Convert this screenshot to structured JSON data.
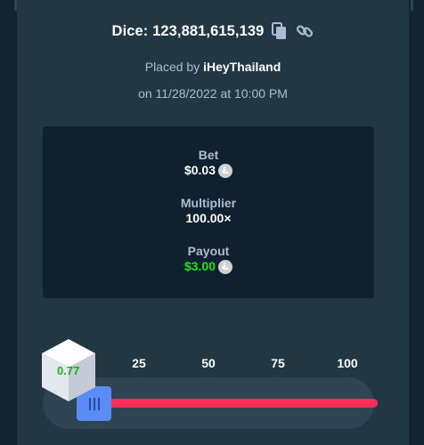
{
  "header": {
    "title": "Dice: 123,881,615,139"
  },
  "icons": {
    "copy": "copy-icon",
    "link": "link-icon",
    "currency": "litecoin-icon",
    "slider_handle": "grip-lines-icon"
  },
  "placement": {
    "prefix": "Placed by ",
    "user": "iHeyThailand",
    "date": "on 11/28/2022 at 10:00 PM"
  },
  "stats": {
    "bet": {
      "label": "Bet",
      "value": "$0.03"
    },
    "multiplier": {
      "label": "Multiplier",
      "value": "100.00×"
    },
    "payout": {
      "label": "Payout",
      "value": "$3.00"
    }
  },
  "slider": {
    "ticks": [
      "25",
      "50",
      "75",
      "100"
    ],
    "result": "0.77",
    "track_range": [
      0,
      100
    ]
  },
  "colors": {
    "win": "#1fe61f",
    "lose": "#ff2e57",
    "handle": "#5a8cf5",
    "panel": "#213743",
    "inner": "#0f212e"
  }
}
